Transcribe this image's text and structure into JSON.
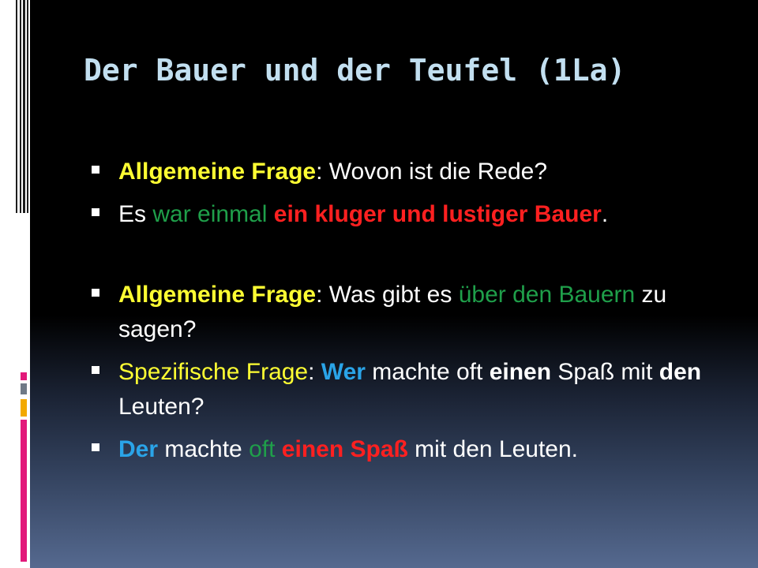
{
  "slide": {
    "title": "Der Bauer und der Teufel (1La)",
    "bullets": [
      {
        "segments": [
          {
            "text": "Allgemeine Frage"
          },
          {
            "text": ": Wovon ist die Rede?"
          }
        ]
      },
      {
        "segments": [
          {
            "text": "Es "
          },
          {
            "text": "war einmal"
          },
          {
            "text": " "
          },
          {
            "text": "ein kluger und lustiger Bauer"
          },
          {
            "text": "."
          }
        ]
      },
      {
        "segments": [
          {
            "text": "Allgemeine Frage"
          },
          {
            "text": ": Was gibt es "
          },
          {
            "text": "über den Bauern"
          },
          {
            "text": " zu sagen?"
          }
        ]
      },
      {
        "segments": [
          {
            "text": "Spezifische Frage"
          },
          {
            "text": ": "
          },
          {
            "text": "Wer"
          },
          {
            "text": " machte oft "
          },
          {
            "text": "einen"
          },
          {
            "text": " Spaß mit "
          },
          {
            "text": "den"
          },
          {
            "text": " Leuten?"
          }
        ]
      },
      {
        "segments": [
          {
            "text": "Der"
          },
          {
            "text": " machte "
          },
          {
            "text": "oft"
          },
          {
            "text": " "
          },
          {
            "text": "einen Spaß"
          },
          {
            "text": " mit den Leuten."
          }
        ]
      }
    ]
  },
  "colors": {
    "title": "#c2dff0",
    "yellow_highlight": "#ffff33",
    "green_highlight": "#1f9f4a",
    "red_highlight": "#ff2020",
    "blue_highlight": "#2aa4e8",
    "accent_pink": "#e2197a",
    "accent_gold": "#f2a900",
    "accent_gray": "#6f7a86"
  }
}
